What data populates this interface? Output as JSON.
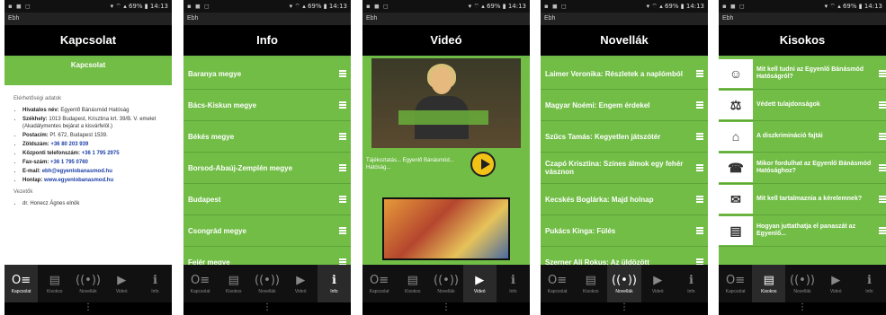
{
  "colors": {
    "accent": "#71bd46",
    "header": "#000000"
  },
  "status": {
    "left_icons": "▪ ◼ ◻",
    "right": "▾ ⌔ ▴ 69% ▮ 14:13"
  },
  "app_name": "Ebh",
  "tabs": [
    {
      "icon": "person-icon",
      "glyph": "O≡",
      "label": "Kapcsolat"
    },
    {
      "icon": "document-icon",
      "glyph": "▤",
      "label": "Kisokos"
    },
    {
      "icon": "broadcast-icon",
      "glyph": "((•))",
      "label": "Novellák"
    },
    {
      "icon": "play-icon",
      "glyph": "▶",
      "label": "Videó"
    },
    {
      "icon": "info-icon",
      "glyph": "ℹ",
      "label": "Info"
    }
  ],
  "soft_menu": "⋮",
  "screen1": {
    "title": "Kapcsolat",
    "header": "Kapcsolat",
    "section1": "Elérhetőségi adatok",
    "items": [
      {
        "k": "Hivatalos név:",
        "v": "Egyenlő Bánásmód Hatóság"
      },
      {
        "k": "Székhely:",
        "v": "1013 Budapest, Krisztina krt. 39/B. V. emelet (Akadálymentes bejárat a kisvárfelöl.)"
      },
      {
        "k": "Postacím:",
        "v": "Pf. 672, Budapest 1539."
      },
      {
        "k": "Zöldszám:",
        "v": "+36 80 203 939"
      },
      {
        "k": "Központi telefonszám:",
        "v": "+36 1 795 2975"
      },
      {
        "k": "Fax-szám:",
        "v": "+36 1 795 0760"
      },
      {
        "k": "E-mail:",
        "v": "ebh@egyenlobanasmod.hu"
      },
      {
        "k": "Honlap:",
        "v": "www.egyenlobanasmod.hu"
      }
    ],
    "section2": "Vezetők",
    "leader": "dr. Honecz Ágnes elnök"
  },
  "screen2": {
    "title": "Info",
    "items": [
      "Baranya megye",
      "Bács-Kiskun megye",
      "Békés megye",
      "Borsod-Abaúj-Zemplén megye",
      "Budapest",
      "Csongrád megye",
      "Fejér megye"
    ]
  },
  "screen3": {
    "title": "Videó",
    "caption": "Tájékoztatás... Egyenlő Bánásmód... Hatóság..."
  },
  "screen4": {
    "title": "Novellák",
    "items": [
      "Laimer Veronika: Részletek a naplómból",
      "Magyar Noémi: Engem érdekel",
      "Szűcs Tamás: Kegyetlen játszótér",
      "Czapó Krisztina: Színes álmok egy fehér vásznon",
      "Kecskés Boglárka: Majd holnap",
      "Pukács Kinga: Fülés",
      "Szerner Ali Rokus: Az üldözött"
    ]
  },
  "screen5": {
    "title": "Kisokos",
    "items": [
      {
        "img": "people-icon",
        "glyph": "☺",
        "text": "Mit kell tudni az Egyenlő Bánásmód Hatóságról?"
      },
      {
        "img": "shield-icon",
        "glyph": "⚖",
        "text": "Védett tulajdonságok"
      },
      {
        "img": "house-icon",
        "glyph": "⌂",
        "text": "A diszkrimináció fajtái"
      },
      {
        "img": "phone-icon",
        "glyph": "☎",
        "text": "Mikor fordulhat az Egyenlő Bánásmód Hatósághoz?"
      },
      {
        "img": "envelope-icon",
        "glyph": "✉",
        "text": "Mit kell tartalmaznia a kérelemnek?"
      },
      {
        "img": "document-icon",
        "glyph": "▤",
        "text": "Hogyan juttathatja el panaszát az Egyenlő..."
      }
    ]
  }
}
